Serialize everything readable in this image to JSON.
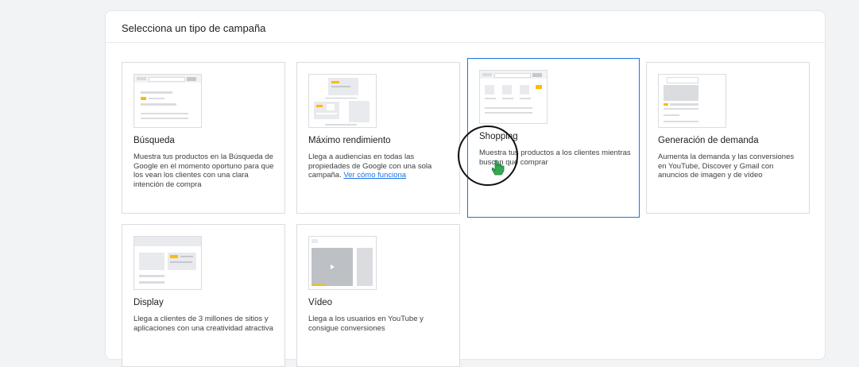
{
  "panel": {
    "title": "Selecciona un tipo de campaña"
  },
  "cards": [
    {
      "title": "Búsqueda",
      "desc": "Muestra tus productos en la Búsqueda de Google en el momento oportuno para que los vean los clientes con una clara intención de compra"
    },
    {
      "title": "Máximo rendimiento",
      "desc": "Llega a audiencias en todas las propiedades de Google con una sola campaña.",
      "link": "Ver cómo funciona"
    },
    {
      "title": "Shopping",
      "desc": "Muestra tus productos a los clientes mientras buscan qué comprar"
    },
    {
      "title": "Generación de demanda",
      "desc": "Aumenta la demanda y las conversiones en YouTube, Discover y Gmail con anuncios de imagen y de vídeo"
    },
    {
      "title": "Display",
      "desc": "Llega a clientes de 3 millones de sitios y aplicaciones con una creatividad atractiva"
    },
    {
      "title": "Vídeo",
      "desc": "Llega a los usuarios en YouTube y consigue conversiones"
    }
  ],
  "thumbnail_text": {
    "search_badge": "Ir"
  },
  "selected_card": "Shopping",
  "colors": {
    "accent": "#1a73e8",
    "yellow": "#fbbc04",
    "gray": "#dadce0"
  }
}
